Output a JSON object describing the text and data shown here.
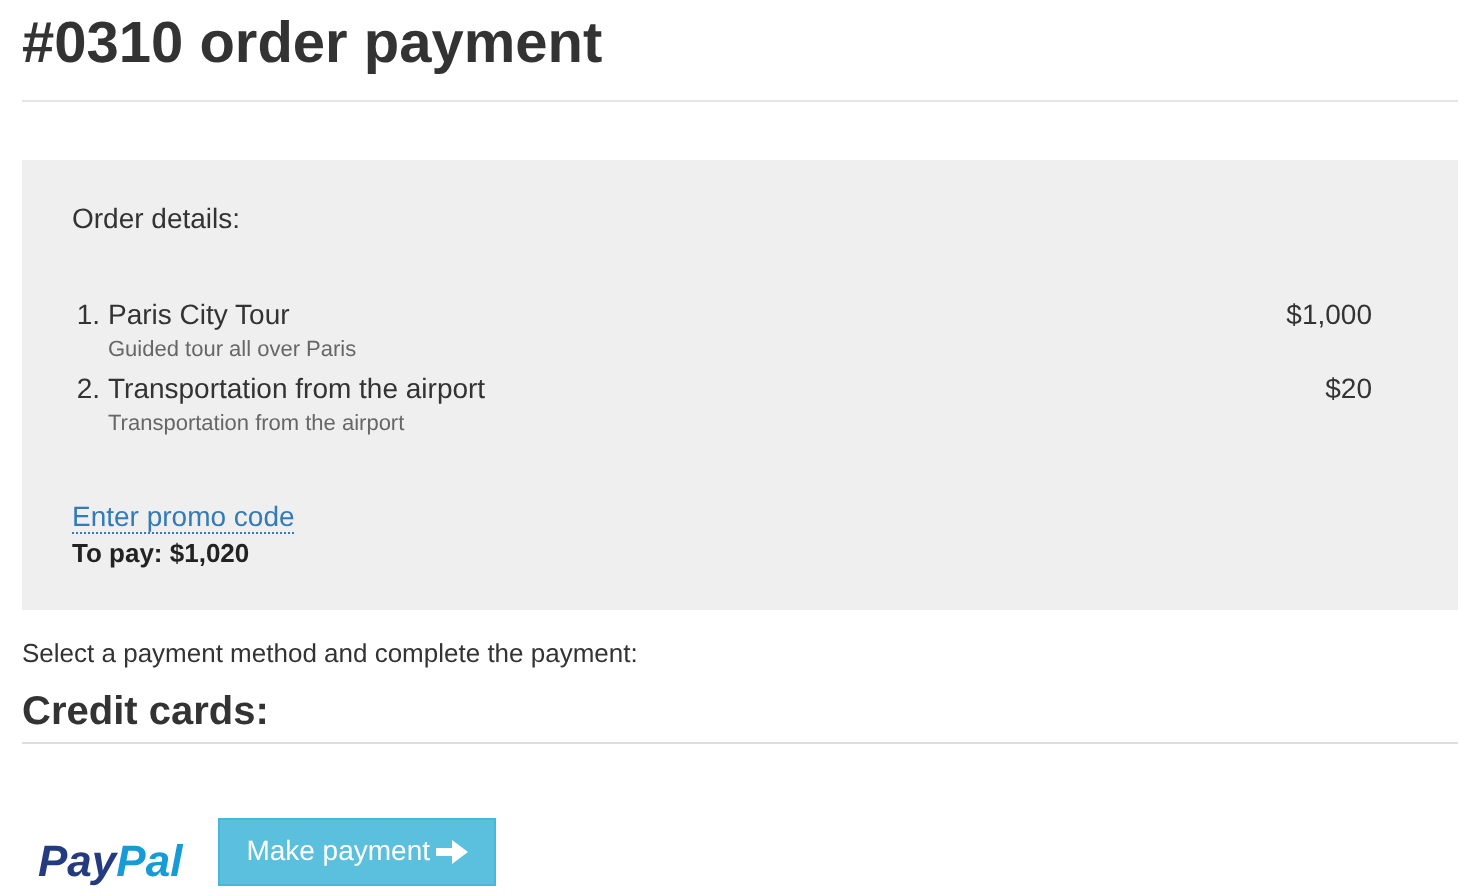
{
  "title": "#0310 order payment",
  "order": {
    "heading": "Order details:",
    "items": [
      {
        "number": "1.",
        "name": "Paris City Tour",
        "description": "Guided tour all over Paris",
        "price": "$1,000"
      },
      {
        "number": "2.",
        "name": "Transportation from the airport",
        "description": "Transportation from the airport",
        "price": "$20"
      }
    ],
    "promo_link": "Enter promo code",
    "total": "To pay: $1,020"
  },
  "instruction": "Select a payment method and complete the payment:",
  "section_title": "Credit cards:",
  "paypal_logo": [
    "Pay",
    "Pal"
  ],
  "pay_button": "Make payment"
}
